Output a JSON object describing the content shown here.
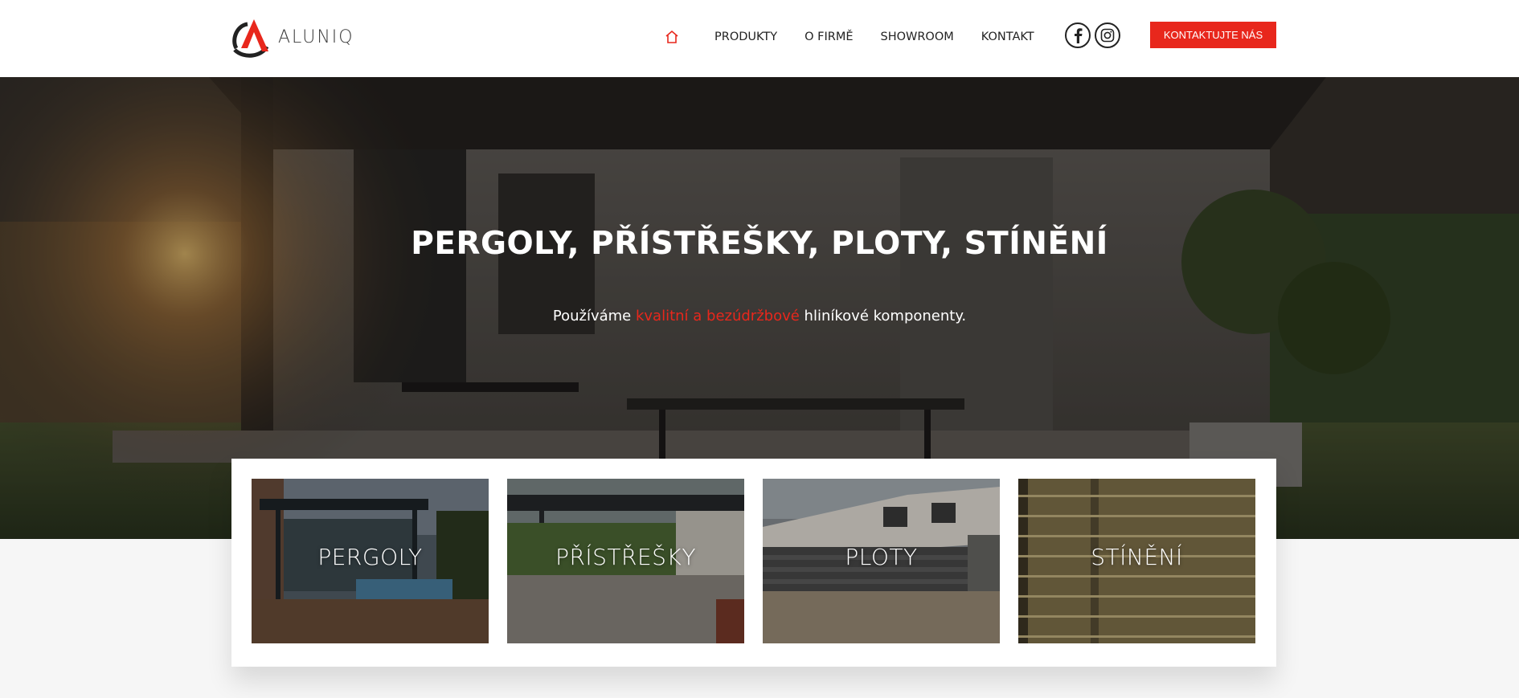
{
  "logo": {
    "text": "ALUNIQ",
    "icon": "aluniq-logo-icon"
  },
  "nav": {
    "home_icon": "home-icon",
    "items": [
      {
        "label": "PRODUKTY"
      },
      {
        "label": "O FIRMĚ"
      },
      {
        "label": "SHOWROOM"
      },
      {
        "label": "KONTAKT"
      }
    ]
  },
  "social": [
    {
      "icon": "facebook-icon"
    },
    {
      "icon": "instagram-icon"
    }
  ],
  "cta": {
    "label": "KONTAKTUJTE NÁS"
  },
  "hero": {
    "title": "PERGOLY, PŘÍSTŘEŠKY, PLOTY, STÍNĚNÍ",
    "subtitle_before": "Používáme ",
    "subtitle_accent": "kvalitní a bezúdržbové",
    "subtitle_after": " hliníkové komponenty."
  },
  "cards": [
    {
      "label": "PERGOLY"
    },
    {
      "label": "PŘÍSTŘEŠKY"
    },
    {
      "label": "PLOTY"
    },
    {
      "label": "STÍNĚNÍ"
    }
  ],
  "colors": {
    "accent": "#e8271c",
    "text_dark": "#222222",
    "background": "#f6f6f6"
  }
}
